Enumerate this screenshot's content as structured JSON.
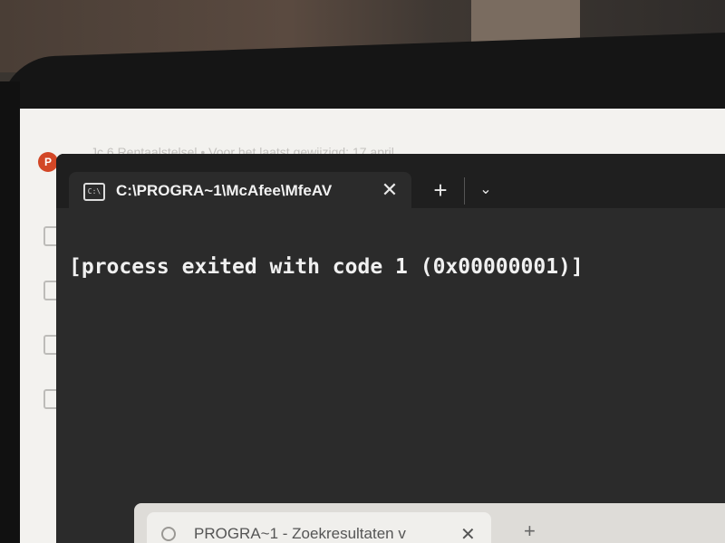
{
  "background_app": {
    "badge": "P",
    "title": "Jc 6 Rentaalstelsel • Voor het laatst gewijzigd: 17 april"
  },
  "terminal": {
    "tab_title": "C:\\PROGRA~1\\McAfee\\MfeAV",
    "tab_close": "✕",
    "new_tab": "+",
    "dropdown": "⌄",
    "tab_icon_text": "C:\\",
    "output_line": "[process exited with code 1 (0x00000001)]"
  },
  "browser": {
    "tab_title": "PROGRA~1 - Zoekresultaten v",
    "tab_close": "✕",
    "new_tab": "+"
  }
}
